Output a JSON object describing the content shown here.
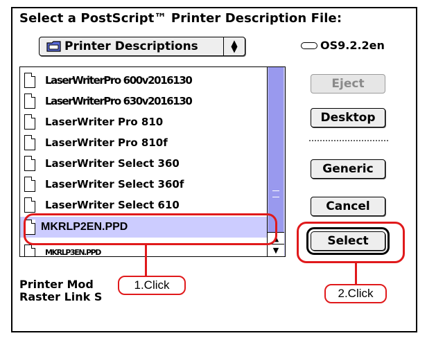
{
  "dialog": {
    "title": "Select a PostScript™ Printer Description File:",
    "popup_label": "Printer Descriptions",
    "popup_arrows": "▲\n▼",
    "volume_name": "OS9.2.2en"
  },
  "file_list": [
    "LaserWriterPro 600v2016130",
    "LaserWriterPro 630v2016130",
    "LaserWriter Pro 810",
    "LaserWriter Pro 810f",
    "LaserWriter Select 360",
    "LaserWriter Select 360f",
    "LaserWriter Select 610",
    "MKRLP2EN.PPD",
    "MKRLP3EN.PPD"
  ],
  "buttons": {
    "eject": "Eject",
    "desktop": "Desktop",
    "generic": "Generic",
    "cancel": "Cancel",
    "select": "Select"
  },
  "info": {
    "line1": "Printer Mod",
    "line2": "Raster Link S"
  },
  "callouts": {
    "first": "1.Click",
    "second": "2.Click"
  },
  "colors": {
    "annotation_red": "#e0191b",
    "selection_highlight": "#ccccff"
  },
  "icons": {
    "folder": "folder-icon",
    "document": "document-icon",
    "disk": "disk-icon"
  }
}
